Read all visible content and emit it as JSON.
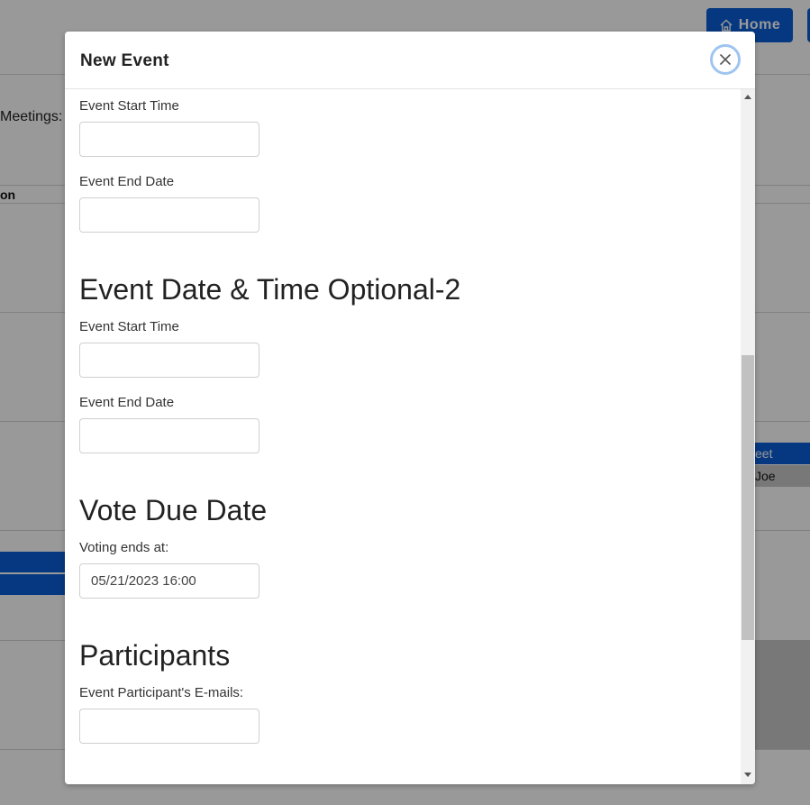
{
  "background": {
    "home_label": "Home",
    "meetings_label": "Meetings:",
    "column_header_fragment": "on",
    "row_blue_fragment": "eet",
    "row_grey_fragment": "Joe"
  },
  "modal": {
    "title": "New Event",
    "close_icon": "close-icon",
    "sections": {
      "optional1": {
        "start_label": "Event Start Time",
        "start_value": "",
        "end_label": "Event End Date",
        "end_value": ""
      },
      "optional2": {
        "heading": "Event Date & Time Optional-2",
        "start_label": "Event Start Time",
        "start_value": "",
        "end_label": "Event End Date",
        "end_value": ""
      },
      "vote": {
        "heading": "Vote Due Date",
        "label": "Voting ends at:",
        "value": "05/21/2023 16:00"
      },
      "participants": {
        "heading": "Participants",
        "label": "Event Participant's E-mails:",
        "value": ""
      }
    }
  },
  "colors": {
    "primary": "#0b5ed7",
    "backdrop": "rgba(0,0,0,0.4)",
    "focus_ring": "#9ec5f0"
  }
}
